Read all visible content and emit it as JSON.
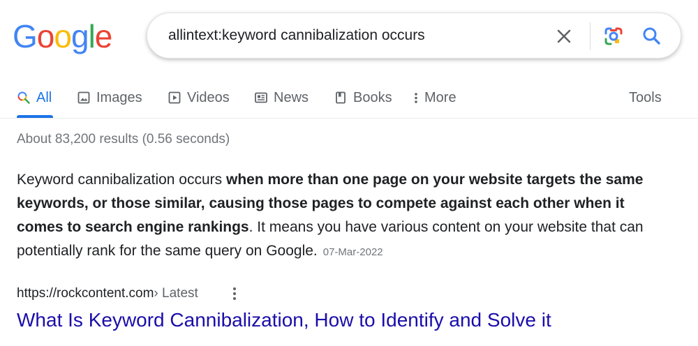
{
  "logo": {
    "letters": [
      "G",
      "o",
      "o",
      "g",
      "l",
      "e"
    ],
    "colors": [
      "#4285F4",
      "#EA4335",
      "#FBBC05",
      "#4285F4",
      "#34A853",
      "#EA4335"
    ]
  },
  "search": {
    "query": "allintext:keyword cannibalization occurs",
    "clear_icon": "close-icon",
    "lens_icon": "camera-lens-icon",
    "search_icon": "search-icon"
  },
  "tabs": [
    {
      "label": "All",
      "icon": "search-icon",
      "active": true
    },
    {
      "label": "Images",
      "icon": "image-icon"
    },
    {
      "label": "Videos",
      "icon": "play-icon"
    },
    {
      "label": "News",
      "icon": "newspaper-icon"
    },
    {
      "label": "Books",
      "icon": "book-icon"
    },
    {
      "label": "More",
      "icon": "vertical-dots-icon"
    },
    {
      "label": "Tools"
    }
  ],
  "results": {
    "stats": "About 83,200 results (0.56 seconds)",
    "snippet": {
      "lead": "Keyword cannibalization occurs ",
      "bold": "when more than one page on your website targets the same keywords, or those similar, causing those pages to compete against each other when it comes to search engine rankings",
      "rest": ". It means you have various content on your website that can potentially rank for the same query on Google.",
      "date": "07-Mar-2022"
    },
    "cite": {
      "url": "https://rockcontent.com",
      "path": " › Latest"
    },
    "title": "What Is Keyword Cannibalization, How to Identify and Solve it"
  },
  "colors": {
    "accent": "#1a73e8",
    "link": "#1a0dab",
    "muted": "#70757a",
    "text": "#202124"
  }
}
